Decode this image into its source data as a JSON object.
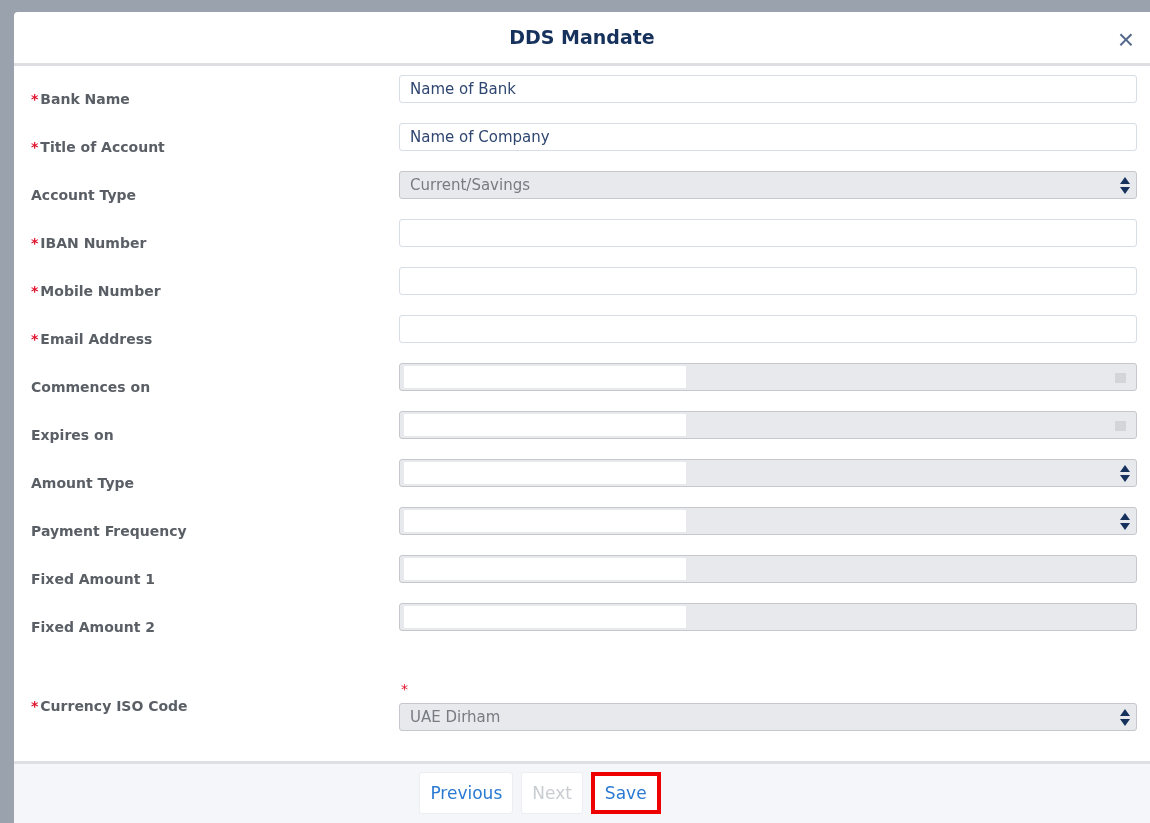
{
  "dialog": {
    "title": "DDS Mandate",
    "close": "×"
  },
  "fields": [
    {
      "label": "Bank Name",
      "required_mark": "*",
      "kind": "text",
      "disabled": false,
      "value": "Name of Bank"
    },
    {
      "label": "Title of Account",
      "required_mark": "*",
      "kind": "text",
      "disabled": false,
      "value": "Name of Company"
    },
    {
      "label": "Account Type",
      "kind": "select",
      "disabled": true,
      "value": "Current/Savings"
    },
    {
      "label": "IBAN Number",
      "required_mark": "*",
      "kind": "text",
      "disabled": false
    },
    {
      "label": "Mobile Number",
      "required_mark": "*",
      "kind": "text",
      "disabled": false
    },
    {
      "label": "Email Address",
      "required_mark": "*",
      "kind": "text",
      "disabled": false
    },
    {
      "label": "Commences on",
      "kind": "date",
      "disabled": true,
      "masked": true
    },
    {
      "label": "Expires on",
      "kind": "date",
      "disabled": true,
      "masked": true
    },
    {
      "label": "Amount Type",
      "kind": "select",
      "disabled": true,
      "masked": true
    },
    {
      "label": "Payment Frequency",
      "kind": "select",
      "disabled": true,
      "masked": true
    },
    {
      "label": "Fixed Amount 1",
      "kind": "text",
      "disabled": true,
      "masked": true
    },
    {
      "label": "Fixed Amount 2",
      "kind": "text",
      "disabled": true,
      "masked": true
    },
    {
      "label": "Currency ISO Code",
      "required_mark": "*",
      "kind": "select",
      "disabled": true,
      "value": "UAE Dirham",
      "field_mark": "*"
    }
  ],
  "buttons": [
    {
      "label": "Previous",
      "disabled": false,
      "highlighted": false
    },
    {
      "label": "Next",
      "disabled": true,
      "highlighted": false
    },
    {
      "label": "Save",
      "disabled": false,
      "highlighted": true
    }
  ]
}
